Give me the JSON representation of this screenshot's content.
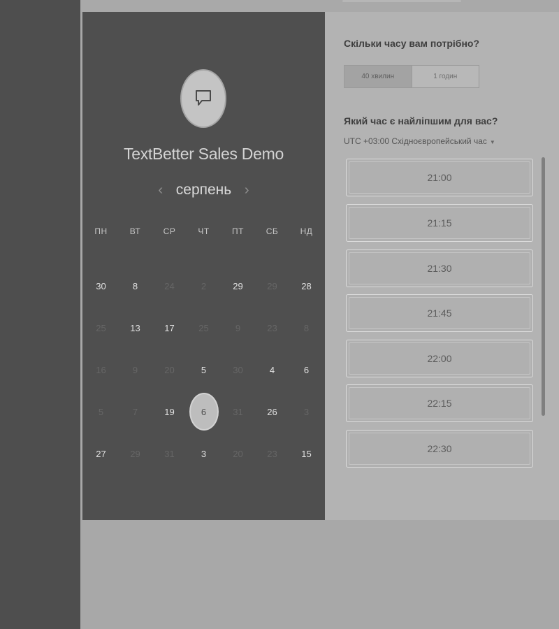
{
  "widget": {
    "company_name": "TextBetter Sales Demo",
    "month": "серпень",
    "prev_arrow": "‹",
    "next_arrow": "›",
    "weekdays": [
      "ПН",
      "ВТ",
      "СР",
      "ЧТ",
      "ПТ",
      "СБ",
      "НД"
    ],
    "days": [
      {
        "label": "30",
        "available": true
      },
      {
        "label": "8",
        "available": true
      },
      {
        "label": "24",
        "available": false
      },
      {
        "label": "2",
        "available": false
      },
      {
        "label": "29",
        "available": true
      },
      {
        "label": "29",
        "available": false
      },
      {
        "label": "28",
        "available": true
      },
      {
        "label": "25",
        "available": false
      },
      {
        "label": "13",
        "available": true
      },
      {
        "label": "17",
        "available": true
      },
      {
        "label": "25",
        "available": false
      },
      {
        "label": "9",
        "available": false
      },
      {
        "label": "23",
        "available": false
      },
      {
        "label": "8",
        "available": false
      },
      {
        "label": "16",
        "available": false
      },
      {
        "label": "9",
        "available": false
      },
      {
        "label": "20",
        "available": false
      },
      {
        "label": "5",
        "available": true
      },
      {
        "label": "30",
        "available": false
      },
      {
        "label": "4",
        "available": true
      },
      {
        "label": "6",
        "available": true
      },
      {
        "label": "5",
        "available": false
      },
      {
        "label": "7",
        "available": false
      },
      {
        "label": "19",
        "available": true
      },
      {
        "label": "6",
        "available": true,
        "selected": true
      },
      {
        "label": "31",
        "available": false
      },
      {
        "label": "26",
        "available": true
      },
      {
        "label": "3",
        "available": false
      },
      {
        "label": "27",
        "available": true
      },
      {
        "label": "29",
        "available": false
      },
      {
        "label": "31",
        "available": false
      },
      {
        "label": "3",
        "available": true
      },
      {
        "label": "20",
        "available": false
      },
      {
        "label": "23",
        "available": false
      },
      {
        "label": "15",
        "available": true
      }
    ]
  },
  "booking": {
    "duration_question": "Скільки часу вам потрібно?",
    "durations": [
      {
        "label": "40 хвилин",
        "active": true
      },
      {
        "label": "1 годин",
        "active": false
      }
    ],
    "time_question": "Який час є найліпшим для вас?",
    "timezone": "UTC +03:00 Східноєвропейський час",
    "slots": [
      "21:00",
      "21:15",
      "21:30",
      "21:45",
      "22:00",
      "22:15",
      "22:30"
    ]
  }
}
